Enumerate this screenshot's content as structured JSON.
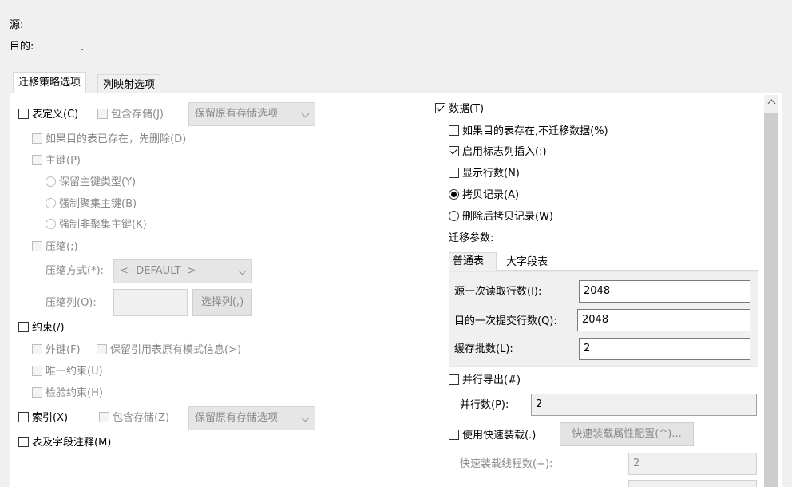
{
  "header": {
    "source_label": "源:",
    "target_label": "目的:",
    "target_value": "-"
  },
  "tabs": [
    {
      "label": "迁移策略选项"
    },
    {
      "label": "列映射选项"
    }
  ],
  "left": {
    "table_def": {
      "label": "表定义(C)",
      "include_storage": "包含存储(J)",
      "storage_select": "保留原有存储选项"
    },
    "drop_if_exists": "如果目的表已存在，先删除(D)",
    "primary_key": "主键(P)",
    "pk_keep_type": "保留主键类型(Y)",
    "pk_force_clustered": "强制聚集主键(B)",
    "pk_force_nonclustered": "强制非聚集主键(K)",
    "compress": "压缩(;)",
    "compress_method_label": "压缩方式(*):",
    "compress_method_value": "<--DEFAULT-->",
    "compress_cols_label": "压缩列(O):",
    "select_cols_button": "选择列(,)",
    "constraints": "约束(/)",
    "foreign_key": "外键(F)",
    "keep_ref_schema": "保留引用表原有模式信息(>)",
    "unique": "唯一约束(U)",
    "check": "检验约束(H)",
    "index": {
      "label": "索引(X)",
      "include_storage": "包含存储(Z)",
      "storage_select": "保留原有存储选项"
    },
    "comments": "表及字段注释(M)"
  },
  "right": {
    "data": "数据(T)",
    "skip_if_exists": "如果目的表存在,不迁移数据(%)",
    "identity_insert": "启用标志列插入(:)",
    "show_rows": "显示行数(N)",
    "copy_records": "拷贝记录(A)",
    "delete_then_copy": "删除后拷贝记录(W)",
    "params_label": "迁移参数:",
    "sub_tabs": [
      {
        "label": "普通表"
      },
      {
        "label": "大字段表"
      }
    ],
    "read_rows_label": "源一次读取行数(I):",
    "read_rows_value": "2048",
    "commit_rows_label": "目的一次提交行数(Q):",
    "commit_rows_value": "2048",
    "cache_batches_label": "缓存批数(L):",
    "cache_batches_value": "2",
    "parallel_export": "并行导出(#)",
    "parallel_count_label": "并行数(P):",
    "parallel_count_value": "2",
    "fast_load": "使用快速装载(.)",
    "fast_load_config_button": "快速装载属性配置(^)...",
    "fast_load_threads_label": "快速装载线程数(+):",
    "fast_load_threads_value": "2"
  },
  "state": {
    "table_def_checked": false,
    "data_checked": true,
    "identity_insert_checked": true,
    "copy_records_selected": true
  }
}
